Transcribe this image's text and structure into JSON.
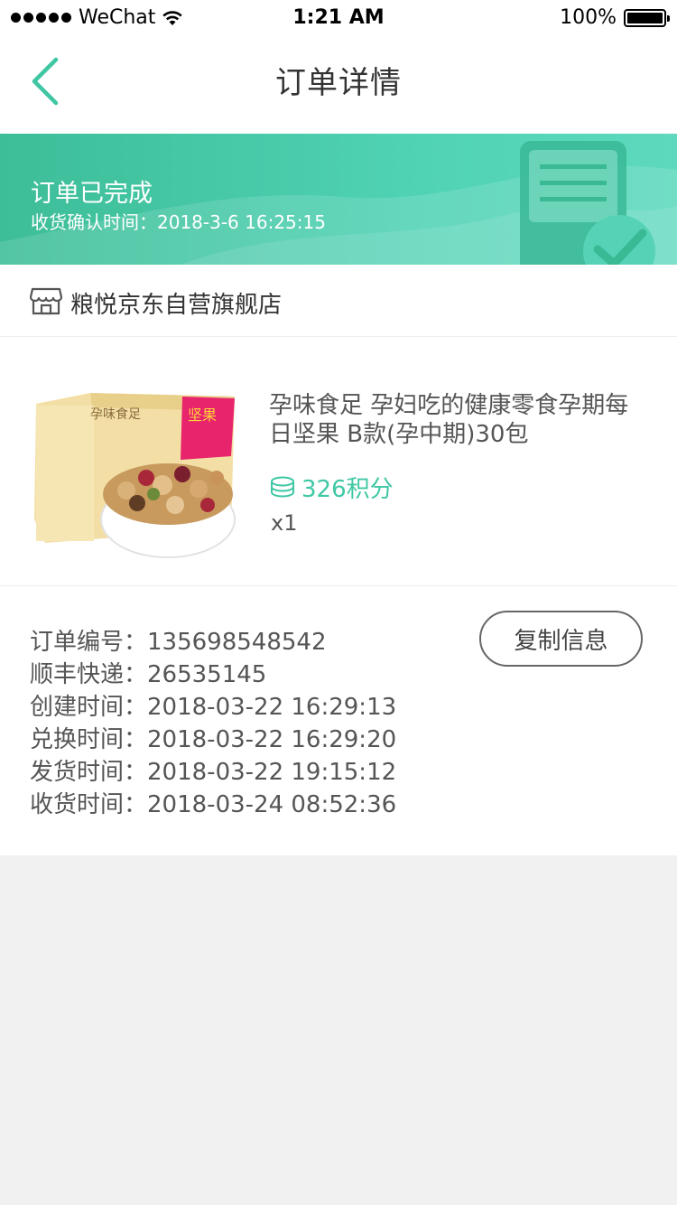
{
  "status_bar": {
    "carrier": "WeChat",
    "time": "1:21 AM",
    "battery": "100%"
  },
  "nav": {
    "title": "订单详情",
    "back_icon": "chevron-left-icon"
  },
  "banner": {
    "title": "订单已完成",
    "subtitle": "收货确认时间：2018-3-6 16:25:15"
  },
  "shop": {
    "icon": "store-icon",
    "name": "粮悦京东自营旗舰店"
  },
  "product": {
    "title": "孕味食足 孕妇吃的健康零食孕期每日坚果 B款(孕中期)30包",
    "points_icon": "coin-stack-icon",
    "points": "326积分",
    "quantity": "x1",
    "image_text_brand": "孕味食足",
    "image_text_badge": "坚果"
  },
  "order_info": {
    "rows": [
      {
        "label": "订单编号：",
        "value": "135698548542"
      },
      {
        "label": "顺丰快递：",
        "value": "26535145"
      },
      {
        "label": "创建时间：",
        "value": "2018-03-22 16:29:13"
      },
      {
        "label": "兑换时间：",
        "value": "2018-03-22 16:29:20"
      },
      {
        "label": "发货时间：",
        "value": "2018-03-22 19:15:12"
      },
      {
        "label": "收货时间：",
        "value": "2018-03-24 08:52:36"
      }
    ],
    "copy_button": "复制信息"
  },
  "colors": {
    "accent": "#3fc7a4",
    "banner_start": "#3dbd98",
    "banner_end": "#5ed9be"
  }
}
